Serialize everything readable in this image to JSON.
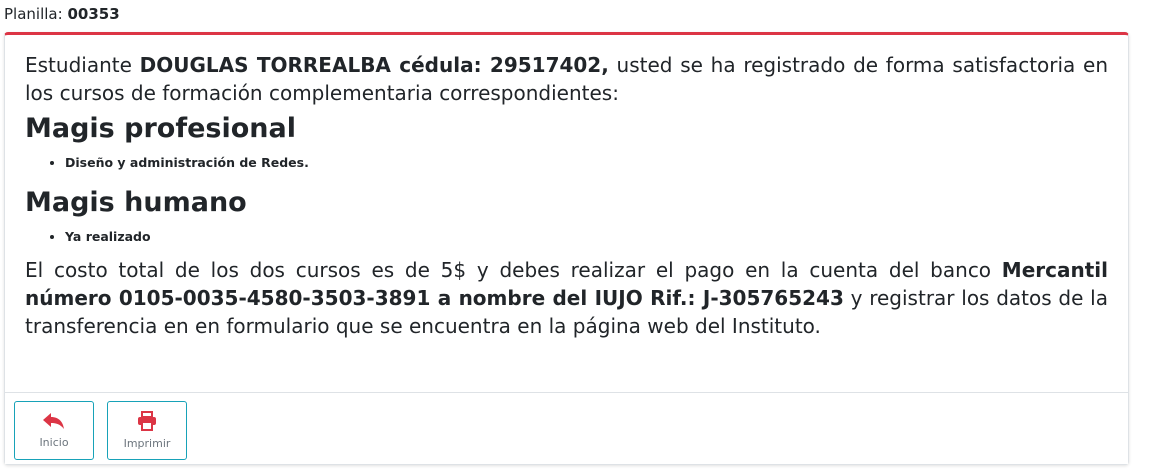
{
  "header": {
    "label": "Planilla:",
    "number": "00353"
  },
  "message": {
    "intro_prefix": "Estudiante ",
    "student": "DOUGLAS TORREALBA cédula: 29517402,",
    "intro_suffix": " usted se ha registrado de forma satisfactoria en los cursos de formación complementaria correspondientes:"
  },
  "sections": [
    {
      "title": "Magis profesional",
      "items": [
        "Diseño y administración de Redes."
      ]
    },
    {
      "title": "Magis humano",
      "items": [
        "Ya realizado"
      ]
    }
  ],
  "payment": {
    "prefix": "El costo total de los dos cursos es de 5$ y debes realizar el pago en la cuenta del banco ",
    "bank_info": "Mercantil número 0105-0035-4580-3503-3891 a nombre del IUJO Rif.: J-305765243",
    "suffix": " y registrar los datos de la transferencia en en formulario que se encuentra en la página web del Instituto."
  },
  "buttons": {
    "home_label": "Inicio",
    "print_label": "Imprimir"
  },
  "colors": {
    "accent": "#dc3545",
    "button_border": "#17a2b8",
    "icon": "#dc3545"
  },
  "icons": {
    "home": "reply-arrow-icon",
    "print": "printer-icon"
  }
}
